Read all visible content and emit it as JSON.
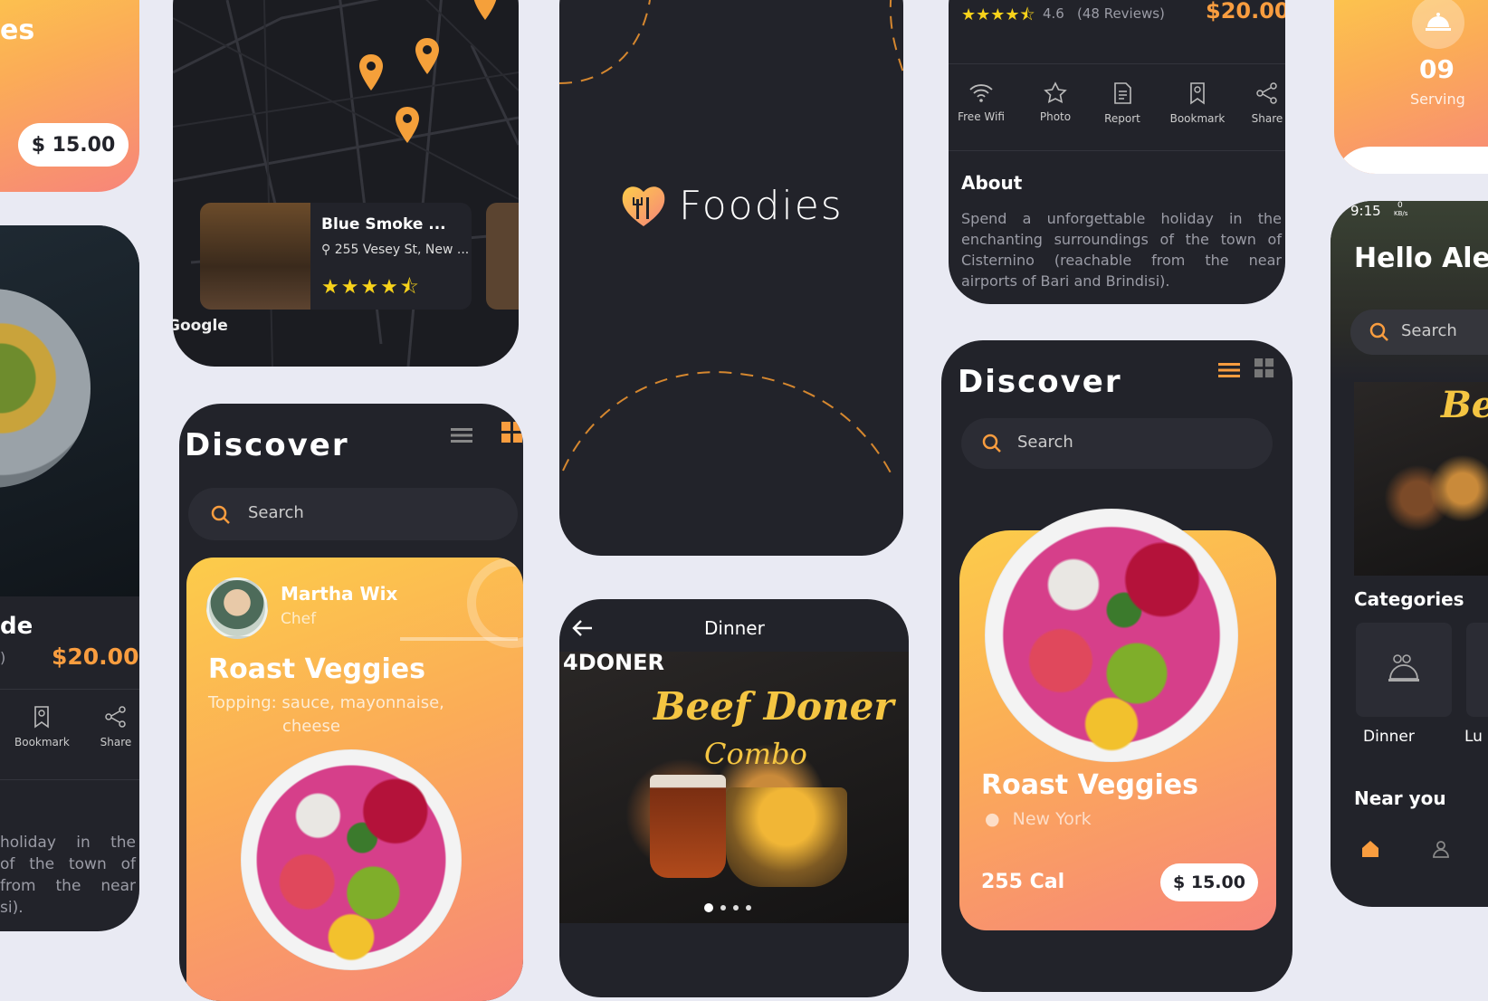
{
  "left_top": {
    "title_frag": "es",
    "price": "$ 15.00"
  },
  "left_mid": {
    "name_frag": "de",
    "reviews_frag": ")",
    "price": "$20.00",
    "actions": [
      "Bookmark",
      "Share"
    ],
    "about_frag": [
      [
        "holiday",
        "in",
        "the"
      ],
      [
        "of",
        "the",
        "town",
        "of"
      ],
      [
        "from",
        "the",
        "near"
      ],
      [
        "si)."
      ]
    ]
  },
  "map": {
    "card_title": "Blue Smoke ...",
    "address": "255 Vesey St, New ...",
    "stars": "★★★★⯪",
    "credit": "Google"
  },
  "discover_left": {
    "title": "Discover",
    "search_placeholder": "Search",
    "chef_name": "Martha Wix",
    "chef_role": "Chef",
    "dish": "Roast Veggies",
    "topping": "Topping: sauce, mayonnaise,",
    "topping2": "cheese"
  },
  "splash": {
    "brand": "Foodies"
  },
  "dinner": {
    "header": "Dinner",
    "brand_text": "4DONER",
    "promo_line1": "Beef Doner",
    "promo_line2": "Combo"
  },
  "detail": {
    "stars": "★★★★⯪",
    "rating": "4.6",
    "reviews": "(48 Reviews)",
    "price": "$20.00",
    "actions": [
      "Free Wifi",
      "Photo",
      "Report",
      "Bookmark",
      "Share"
    ],
    "about_title": "About",
    "about_lines": [
      [
        "Spend",
        "a",
        "unforgettable",
        "holiday",
        "in",
        "the"
      ],
      [
        "enchanting",
        "surroundings",
        "of",
        "the",
        "town",
        "of"
      ],
      [
        "Cisternino",
        "(reachable",
        "from",
        "the",
        "near"
      ],
      [
        "airports of Bari and Brindisi)."
      ]
    ]
  },
  "discover_right": {
    "title": "Discover",
    "search_placeholder": "Search",
    "dish": "Roast Veggies",
    "location": "New York",
    "calories": "255 Cal",
    "price": "$ 15.00"
  },
  "serving": {
    "count": "09",
    "label": "Serving"
  },
  "home": {
    "time": "9:15",
    "net_value": "0",
    "net_unit": "KB/s",
    "greeting": "Hello Ale",
    "search_placeholder": "Search",
    "promo_frag": "Bee",
    "categories_title": "Categories",
    "categories": [
      "Dinner",
      "Lu"
    ],
    "near_title": "Near you"
  },
  "colors": {
    "bg": "#e9eaf3",
    "card": "#22232a",
    "accent": "#f99d3f",
    "gradient_start": "#fccc4a",
    "gradient_end": "#f7857a"
  }
}
